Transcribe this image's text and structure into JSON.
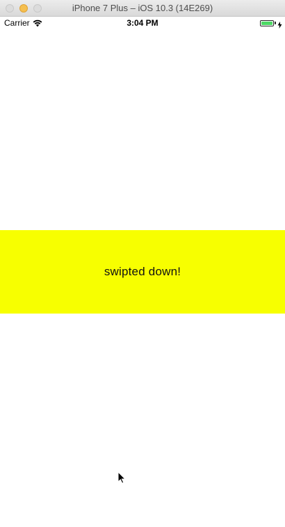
{
  "window": {
    "title": "iPhone 7 Plus – iOS 10.3 (14E269)"
  },
  "status_bar": {
    "carrier": "Carrier",
    "time": "3:04 PM",
    "battery_level": 1.0,
    "charging": true,
    "colors": {
      "battery_fill": "#4cd964"
    }
  },
  "main": {
    "banner_text": "swipted down!",
    "banner_color": "#f7ff00"
  },
  "icons": {
    "wifi": "wifi-icon",
    "battery": "battery-icon",
    "charging": "charging-icon",
    "cursor": "mouse-cursor-icon"
  }
}
